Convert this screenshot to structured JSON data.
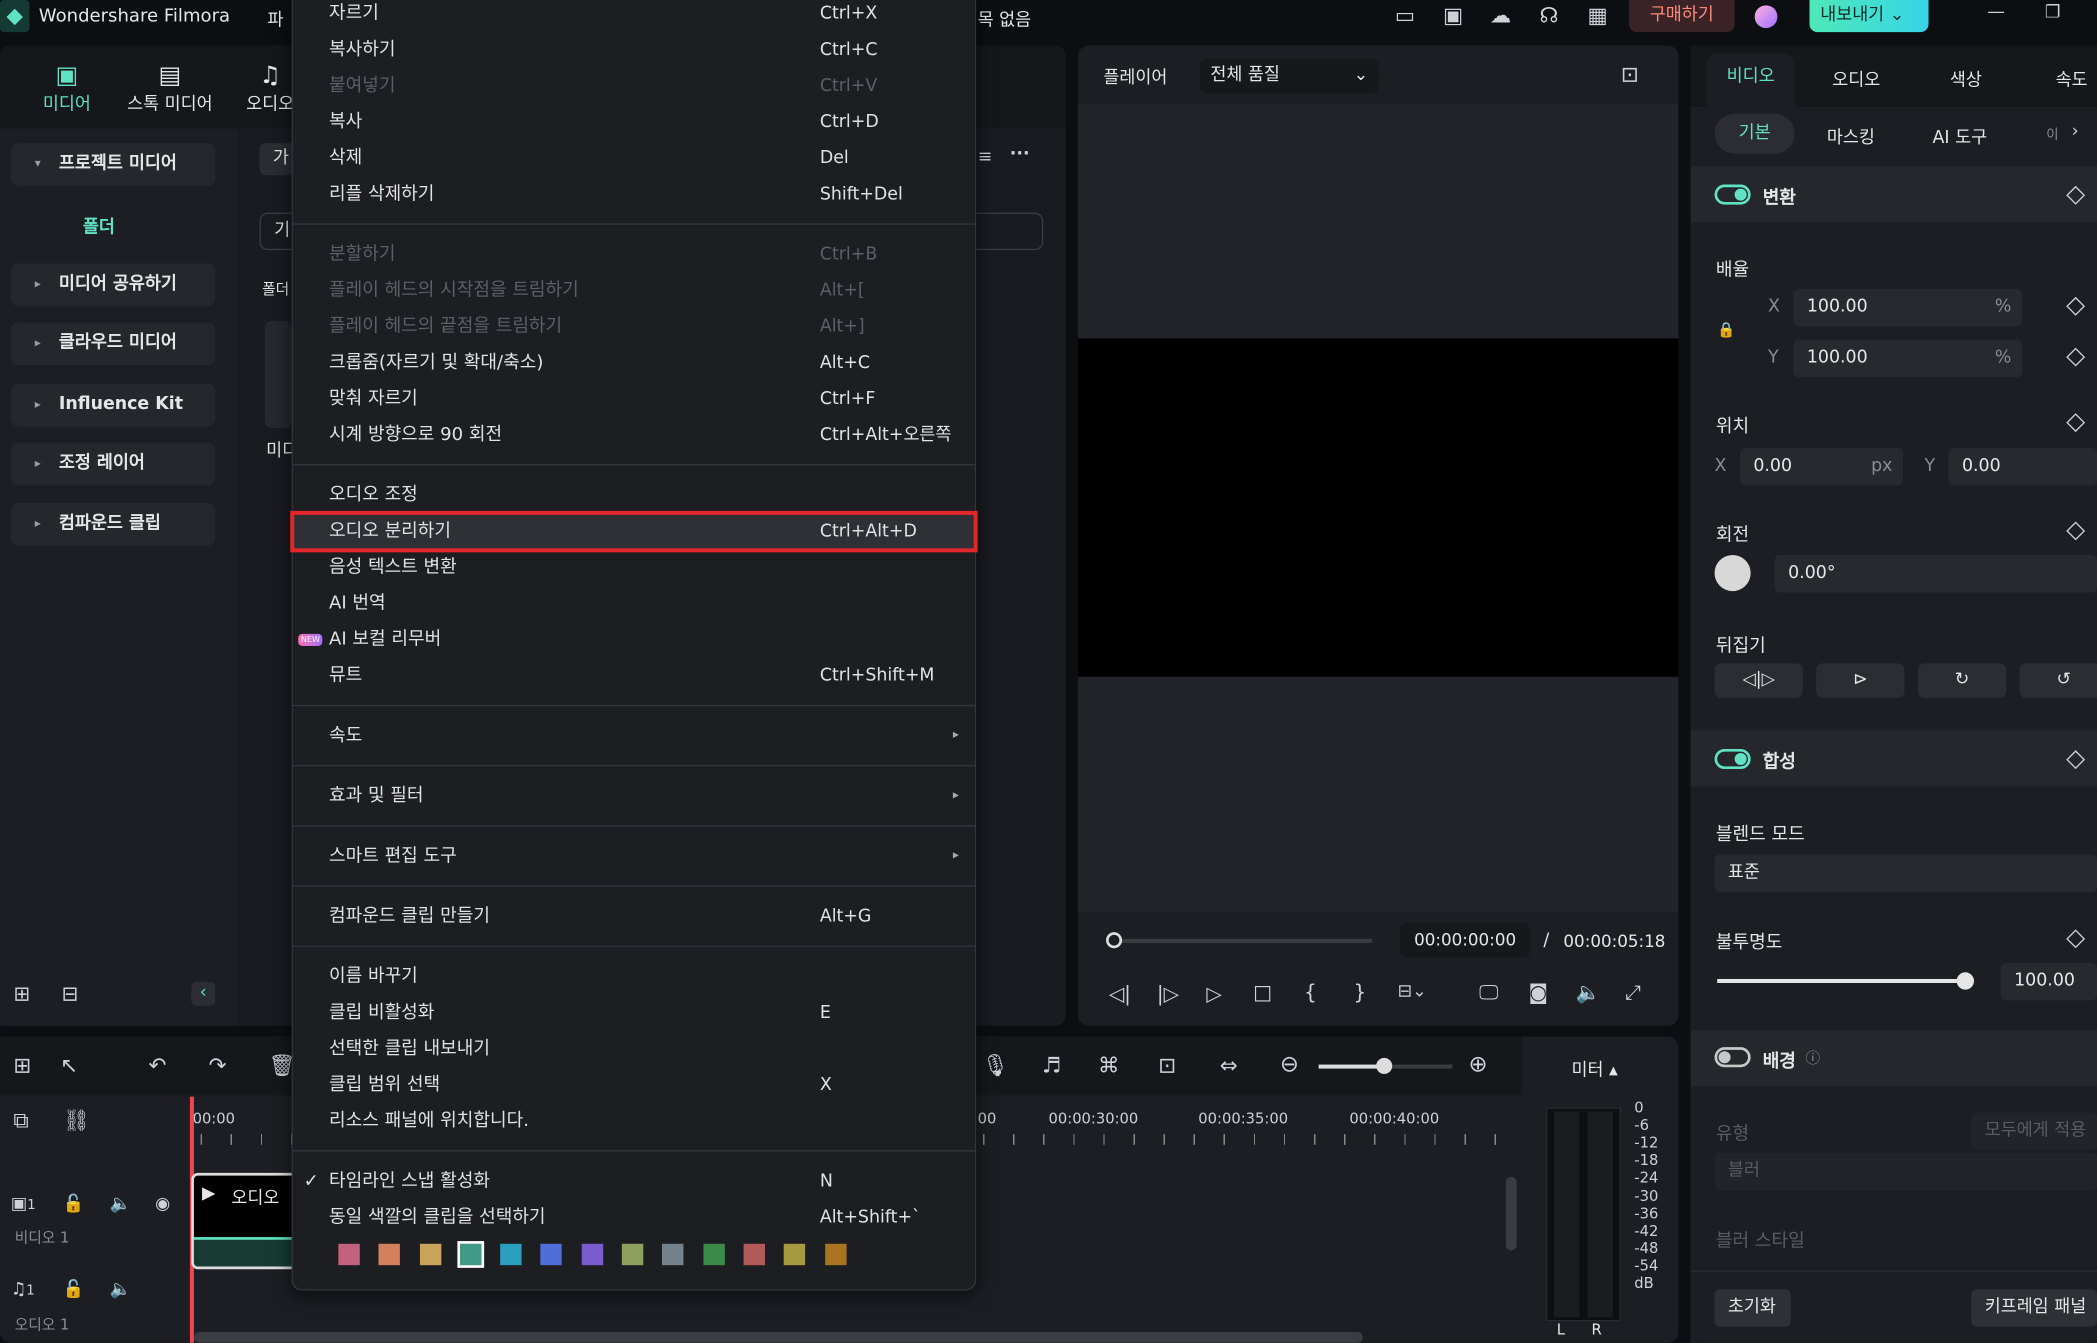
{
  "app": {
    "title": "Wondershare Filmora",
    "menu_partial": "파",
    "project_partial": "목 없음",
    "buy": "구매하기",
    "export": "내보내기"
  },
  "top_icons": [
    "layout-icon",
    "save-icon",
    "cloud-upload-icon",
    "headset-icon",
    "grid-apps-icon"
  ],
  "media_tabs": [
    {
      "label": "미디어",
      "active": true
    },
    {
      "label": "스톡 미디어"
    },
    {
      "label": "오디오"
    }
  ],
  "sidebar": {
    "items": [
      {
        "label": "프로젝트 미디어",
        "open": true
      },
      {
        "label": "미디어 공유하기"
      },
      {
        "label": "클라우드 미디어"
      },
      {
        "label": "Influence Kit"
      },
      {
        "label": "조정 레이어"
      },
      {
        "label": "컴파운드 클립"
      }
    ],
    "folder": "폴더"
  },
  "media_partials": {
    "a": "가",
    "b": "기",
    "c": "폴더",
    "d": "미디"
  },
  "context_menu": {
    "sections": [
      [
        {
          "label": "자르기",
          "shortcut": "Ctrl+X"
        },
        {
          "label": "복사하기",
          "shortcut": "Ctrl+C"
        },
        {
          "label": "붙여넣기",
          "shortcut": "Ctrl+V",
          "disabled": true
        },
        {
          "label": "복사",
          "shortcut": "Ctrl+D"
        },
        {
          "label": "삭제",
          "shortcut": "Del"
        },
        {
          "label": "리플 삭제하기",
          "shortcut": "Shift+Del"
        }
      ],
      [
        {
          "label": "분할하기",
          "shortcut": "Ctrl+B",
          "disabled": true
        },
        {
          "label": "플레이 헤드의 시작점을 트림하기",
          "shortcut": "Alt+[",
          "disabled": true
        },
        {
          "label": "플레이 헤드의 끝점을 트림하기",
          "shortcut": "Alt+]",
          "disabled": true
        },
        {
          "label": "크롭줌(자르기 및 확대/축소)",
          "shortcut": "Alt+C"
        },
        {
          "label": "맞춰 자르기",
          "shortcut": "Ctrl+F"
        },
        {
          "label": "시계 방향으로 90 회전",
          "shortcut": "Ctrl+Alt+오른쪽"
        }
      ],
      [
        {
          "label": "오디오 조정",
          "shortcut": ""
        },
        {
          "label": "오디오 분리하기",
          "shortcut": "Ctrl+Alt+D",
          "highlighted": true
        },
        {
          "label": "음성 텍스트 변환",
          "shortcut": ""
        },
        {
          "label": "AI 번역",
          "shortcut": ""
        },
        {
          "label": "AI 보컬 리무버",
          "shortcut": "",
          "badge": "NEW"
        },
        {
          "label": "뮤트",
          "shortcut": "Ctrl+Shift+M"
        }
      ],
      [
        {
          "label": "속도",
          "submenu": true
        }
      ],
      [
        {
          "label": "효과 및 필터",
          "submenu": true
        }
      ],
      [
        {
          "label": "스마트 편집 도구",
          "submenu": true
        }
      ],
      [
        {
          "label": "컴파운드 클립 만들기",
          "shortcut": "Alt+G"
        }
      ],
      [
        {
          "label": "이름 바꾸기",
          "shortcut": ""
        },
        {
          "label": "클립 비활성화",
          "shortcut": "E"
        },
        {
          "label": "선택한 클립 내보내기",
          "shortcut": ""
        },
        {
          "label": "클립 범위 선택",
          "shortcut": "X"
        },
        {
          "label": "리소스 패널에 위치합니다.",
          "shortcut": ""
        }
      ],
      [
        {
          "label": "타임라인 스냅 활성화",
          "shortcut": "N",
          "checked": true
        },
        {
          "label": "동일 색깔의 클립을 선택하기",
          "shortcut": "Alt+Shift+`"
        }
      ]
    ],
    "colors": [
      "#c2627e",
      "#d4805c",
      "#c9a35a",
      "#3f9b85",
      "#2a9fc0",
      "#4e6fd8",
      "#7a5bd0",
      "#8ea05e",
      "#75828e",
      "#3b8a48",
      "#b25a5a",
      "#a79a40",
      "#a8741f"
    ],
    "selected_color": "#3f9b85"
  },
  "player": {
    "label": "플레이어",
    "quality": "전체 품질",
    "current": "00:00:00:00",
    "separator": "/",
    "total": "00:00:05:18",
    "progress": 0
  },
  "props": {
    "tabs": [
      "비디오",
      "오디오",
      "색상",
      "속도"
    ],
    "subtabs": [
      "기본",
      "마스킹",
      "AI 도구",
      "이"
    ],
    "transform": {
      "title": "변환",
      "scale": "배율",
      "x_label": "X",
      "y_label": "Y",
      "scale_x": "100.00",
      "scale_y": "100.00",
      "unit_pct": "%",
      "position": "위치",
      "pos_x": "0.00",
      "pos_y": "0.00",
      "unit_px": "px",
      "rotation": "회전",
      "rot": "0.00°",
      "flip": "뒤집기"
    },
    "composite": {
      "title": "합성",
      "blend": "블렌드 모드",
      "blend_value": "표준",
      "opacity": "불투명도",
      "opacity_value": "100.00",
      "opacity_level": 100
    },
    "background": {
      "title": "배경",
      "type": "유형",
      "apply_all": "모두에게 적용",
      "blur": "블러",
      "blur_style": "블러 스타일",
      "enabled": false
    },
    "reset": "초기화",
    "keyframe": "키프레임 패널"
  },
  "timeline": {
    "ticks": [
      "00:00",
      "00",
      "00:00:30:00",
      "00:00:35:00",
      "00:00:40:00"
    ],
    "meter": "미터",
    "meter_scale": [
      "0",
      "-6",
      "-12",
      "-18",
      "-24",
      "-30",
      "-36",
      "-42",
      "-48",
      "-54",
      "dB"
    ],
    "lr": [
      "L",
      "R"
    ],
    "tracks": [
      {
        "label": "비디오 1",
        "num": "1"
      },
      {
        "label": "오디오 1",
        "num": "1"
      }
    ],
    "clip": "오디오"
  }
}
